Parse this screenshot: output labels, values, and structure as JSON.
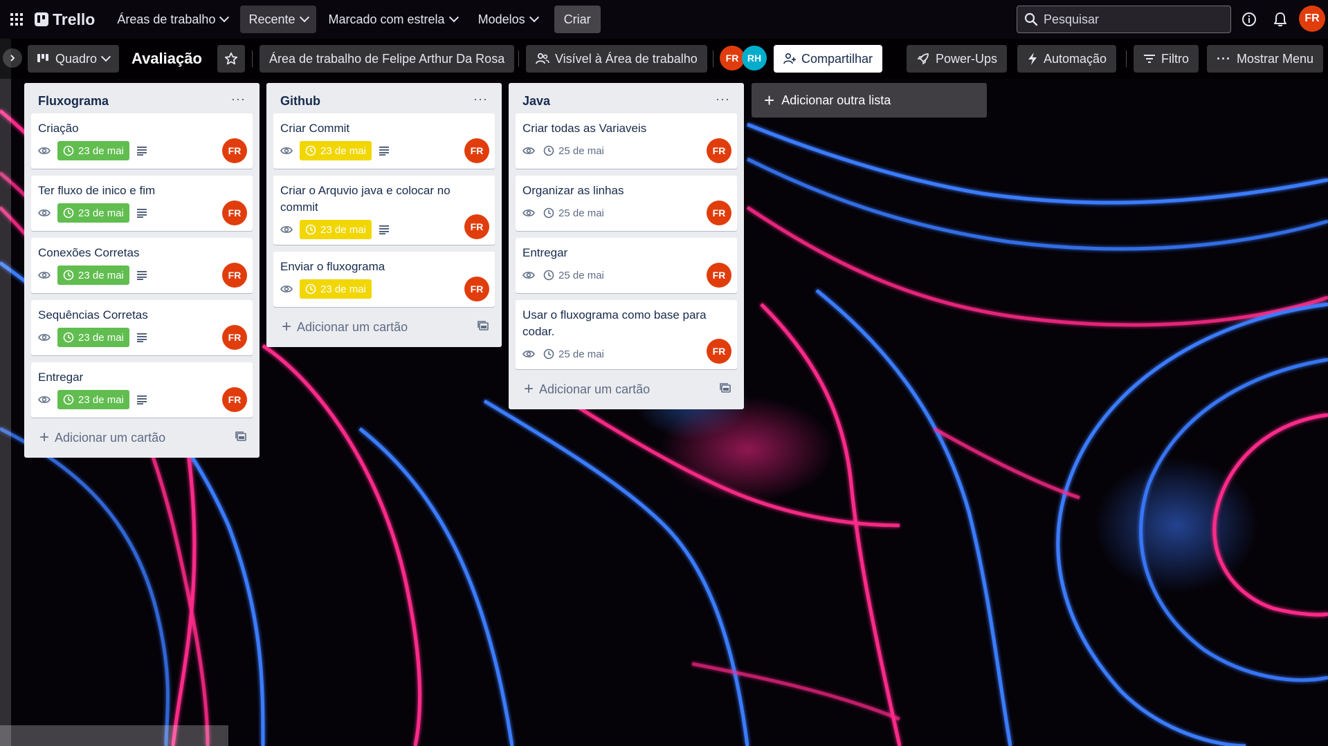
{
  "topbar": {
    "app_name": "Trello",
    "menus": [
      {
        "label": "Áreas de trabalho",
        "active": false
      },
      {
        "label": "Recente",
        "active": true
      },
      {
        "label": "Marcado com estrela",
        "active": false
      },
      {
        "label": "Modelos",
        "active": false
      }
    ],
    "create_label": "Criar",
    "search_placeholder": "Pesquisar",
    "user_initials": "FR"
  },
  "board": {
    "view_label": "Quadro",
    "title": "Avaliação",
    "workspace_label": "Área de trabalho de Felipe Arthur Da Rosa",
    "visibility_label": "Visível à Área de trabalho",
    "members": [
      {
        "initials": "FR",
        "color": "#e13d0c"
      },
      {
        "initials": "RH",
        "color": "#00aecc"
      }
    ],
    "share_label": "Compartilhar",
    "powerups_label": "Power-Ups",
    "automation_label": "Automação",
    "filter_label": "Filtro",
    "menu_label": "Mostrar Menu"
  },
  "lists": [
    {
      "title": "Fluxograma",
      "add_card_label": "Adicionar um cartão",
      "cards": [
        {
          "title": "Criação",
          "due": "23 de mai",
          "due_style": "green",
          "has_description": true,
          "member": "FR"
        },
        {
          "title": "Ter fluxo de inico e fim",
          "due": "23 de mai",
          "due_style": "green",
          "has_description": true,
          "member": "FR"
        },
        {
          "title": "Conexões Corretas",
          "due": "23 de mai",
          "due_style": "green",
          "has_description": true,
          "member": "FR"
        },
        {
          "title": "Sequências Corretas",
          "due": "23 de mai",
          "due_style": "green",
          "has_description": true,
          "member": "FR"
        },
        {
          "title": "Entregar",
          "due": "23 de mai",
          "due_style": "green",
          "has_description": true,
          "member": "FR"
        }
      ]
    },
    {
      "title": "Github",
      "add_card_label": "Adicionar um cartão",
      "cards": [
        {
          "title": "Criar Commit",
          "due": "23 de mai",
          "due_style": "yellow",
          "has_description": true,
          "member": "FR"
        },
        {
          "title": "Criar o Arquvio java e colocar no commit",
          "due": "23 de mai",
          "due_style": "yellow",
          "has_description": true,
          "member": "FR"
        },
        {
          "title": "Enviar o fluxograma",
          "due": "23 de mai",
          "due_style": "yellow",
          "has_description": false,
          "member": "FR"
        }
      ]
    },
    {
      "title": "Java",
      "add_card_label": "Adicionar um cartão",
      "cards": [
        {
          "title": "Criar todas as Variaveis",
          "due": "25 de mai",
          "due_style": "plain",
          "has_description": false,
          "member": "FR"
        },
        {
          "title": "Organizar as linhas",
          "due": "25 de mai",
          "due_style": "plain",
          "has_description": false,
          "member": "FR"
        },
        {
          "title": "Entregar",
          "due": "25 de mai",
          "due_style": "plain",
          "has_description": false,
          "member": "FR"
        },
        {
          "title": "Usar o fluxograma como base para codar.",
          "due": "25 de mai",
          "due_style": "plain",
          "has_description": false,
          "member": "FR"
        }
      ]
    }
  ],
  "add_list_label": "Adicionar outra lista",
  "colors": {
    "due_green": "#61bd4f",
    "due_yellow": "#f2d600",
    "avatar_orange": "#e13d0c",
    "list_bg": "#ebecf0"
  }
}
